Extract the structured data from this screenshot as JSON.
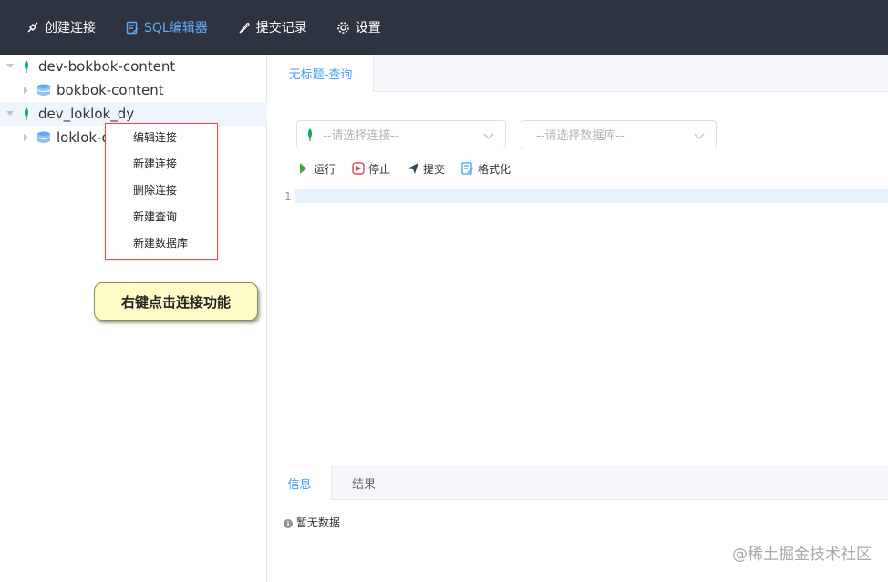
{
  "nav": {
    "items": [
      {
        "label": "创建连接",
        "icon": "plug-icon"
      },
      {
        "label": "SQL编辑器",
        "icon": "edit-doc-icon",
        "active": true
      },
      {
        "label": "提交记录",
        "icon": "feather-icon"
      },
      {
        "label": "设置",
        "icon": "gear-icon"
      }
    ],
    "accent": "#5ea8f5",
    "bg": "#2d3440"
  },
  "tree": {
    "nodes": [
      {
        "label": "dev-bokbok-content",
        "icon": "leaf-icon",
        "expanded": true
      },
      {
        "label": "bokbok-content",
        "icon": "database-icon",
        "expanded": false
      },
      {
        "label": "dev_loklok_dy",
        "icon": "leaf-icon",
        "expanded": true
      },
      {
        "label": "loklok-d",
        "icon": "database-icon",
        "expanded": false
      }
    ]
  },
  "context_menu": {
    "items": [
      "编辑连接",
      "新建连接",
      "删除连接",
      "新建查询",
      "新建数据库"
    ]
  },
  "callout": {
    "text": "右键点击连接功能"
  },
  "editor_tab": {
    "label": "无标题-查询"
  },
  "selects": {
    "connection_placeholder": "--请选择连接--",
    "database_placeholder": "--请选择数据库--"
  },
  "toolbar": {
    "run": "运行",
    "stop": "停止",
    "submit": "提交",
    "format": "格式化"
  },
  "editor": {
    "line_number": "1"
  },
  "result_tabs": {
    "info": "信息",
    "result": "结果"
  },
  "empty_text": "暂无数据",
  "watermark": "@稀土掘金技术社区"
}
